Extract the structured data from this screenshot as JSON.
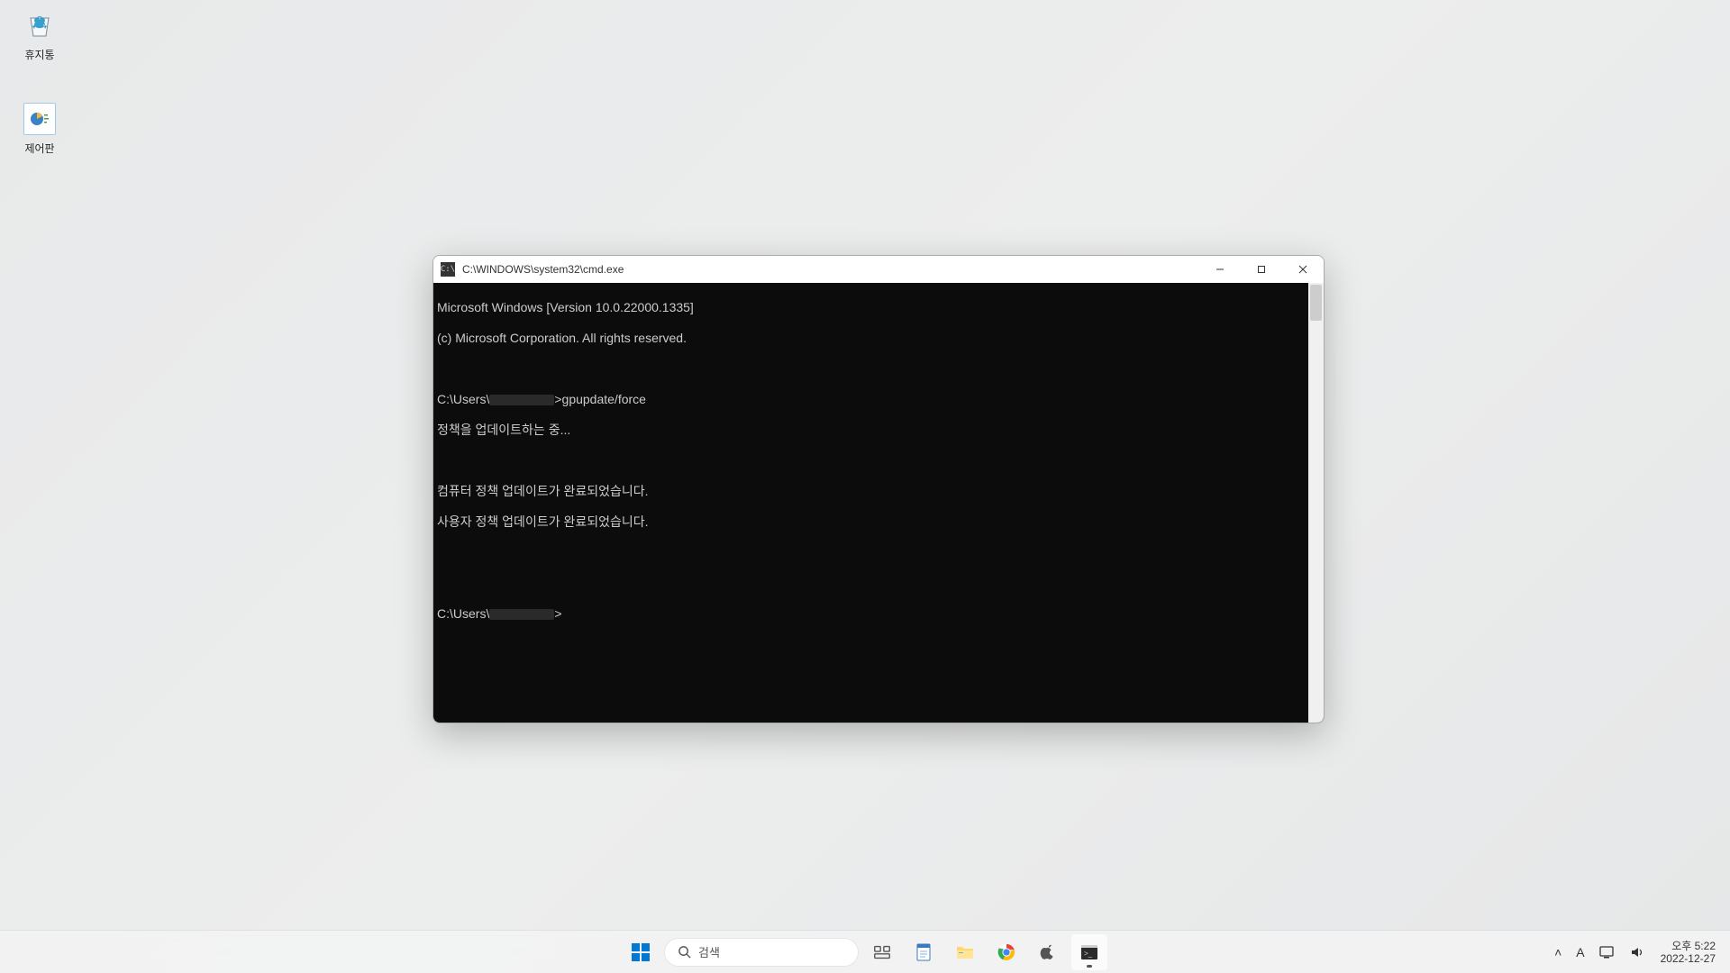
{
  "desktop": {
    "icons": [
      {
        "name": "recycle-bin",
        "label": "휴지통"
      },
      {
        "name": "control-panel",
        "label": "제어판"
      }
    ]
  },
  "window": {
    "title": "C:\\WINDOWS\\system32\\cmd.exe",
    "icon_label": "C:\\",
    "controls": {
      "min": "—",
      "max": "▢",
      "close": "✕"
    },
    "terminal": {
      "header1": "Microsoft Windows [Version 10.0.22000.1335]",
      "header2": "(c) Microsoft Corporation. All rights reserved.",
      "prompt_prefix": "C:\\Users\\",
      "prompt_suffix": ">",
      "command": "gpupdate/force",
      "status1": "정책을 업데이트하는 중...",
      "status2": "컴퓨터 정책 업데이트가 완료되었습니다.",
      "status3": "사용자 정책 업데이트가 완료되었습니다."
    }
  },
  "taskbar": {
    "search_placeholder": "검색",
    "icons": {
      "start": "start-icon",
      "task_view": "task-view-icon",
      "notepad": "notepad-icon",
      "explorer": "file-explorer-icon",
      "chrome": "chrome-icon",
      "apple": "apple-icon",
      "cmd": "terminal-icon"
    }
  },
  "tray": {
    "chevron": "˄",
    "ime": "A",
    "time": "오후 5:22",
    "date": "2022-12-27"
  }
}
